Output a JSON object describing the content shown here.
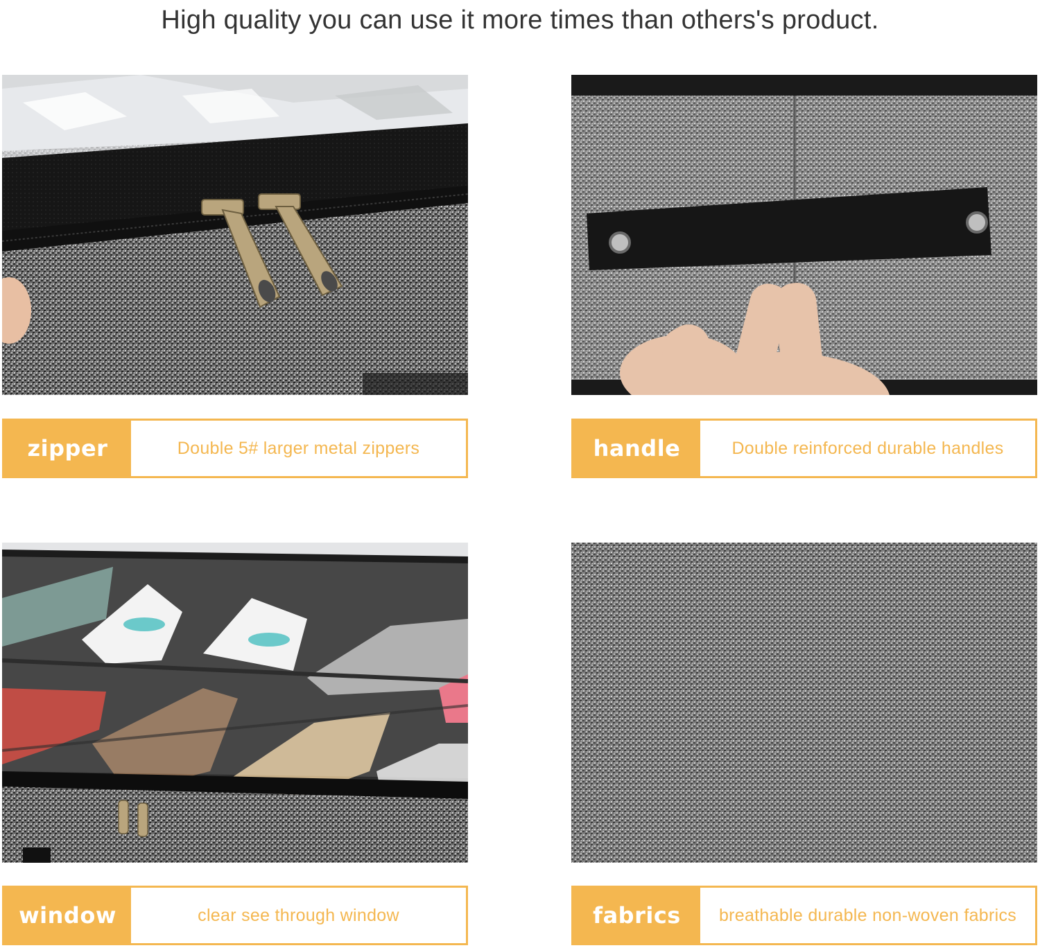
{
  "headline": "High quality you can use it more times than others's product.",
  "features": [
    {
      "tag": "zipper",
      "description": "Double 5# larger metal zippers"
    },
    {
      "tag": "handle",
      "description": "Double reinforced durable handles"
    },
    {
      "tag": "window",
      "description": "clear see through window"
    },
    {
      "tag": "fabrics",
      "description": "breathable durable non-woven fabrics"
    }
  ],
  "colors": {
    "accent": "#f4b750",
    "headline_text": "#333333"
  }
}
